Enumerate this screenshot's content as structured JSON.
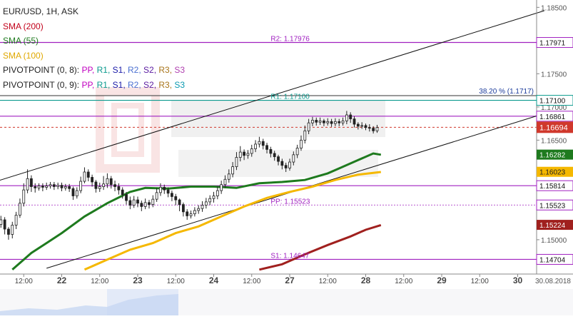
{
  "chart_data": {
    "type": "candlestick",
    "instrument": "EUR/USD, 1H, ASK",
    "legend": {
      "sma200": "SMA (200)",
      "sma55": "SMA (55)",
      "sma100": "SMA (100)",
      "pivot1_prefix": "PIVOTPOINT (0, 8): ",
      "pivot2_prefix": "PIVOTPOINT (0, 9): ",
      "pivot_labels": [
        "PP,",
        "R1,",
        "S1,",
        "R2,",
        "S2,",
        "R3,",
        "S3"
      ]
    },
    "colors": {
      "sma200": "#a0201e",
      "sma55": "#1e7a1e",
      "sma100": "#f5b800",
      "pivot_line": "#a020c0",
      "r1_line": "#0b9a8e",
      "current_price": "#d0382c"
    },
    "y_axis": {
      "ylim": [
        1.1455,
        1.1855
      ],
      "ticks": [
        1.185,
        1.18,
        1.175,
        1.17,
        1.165,
        1.16,
        1.155,
        1.15
      ],
      "tick_labels": [
        "1.18500",
        "1.18000",
        "1.17500",
        "1.17000",
        "1.16500",
        "1.16000",
        "1.15500",
        "1.15000"
      ]
    },
    "x_axis": {
      "ticks": [
        {
          "t": 0.5,
          "label": "12:00",
          "bold": false
        },
        {
          "t": 1.0,
          "label": "22",
          "bold": true
        },
        {
          "t": 1.5,
          "label": "12:00",
          "bold": false
        },
        {
          "t": 2.0,
          "label": "23",
          "bold": true
        },
        {
          "t": 2.5,
          "label": "12:00",
          "bold": false
        },
        {
          "t": 3.0,
          "label": "24",
          "bold": true
        },
        {
          "t": 3.5,
          "label": "12:00",
          "bold": false
        },
        {
          "t": 4.0,
          "label": "27",
          "bold": true
        },
        {
          "t": 4.5,
          "label": "12:00",
          "bold": false
        },
        {
          "t": 5.0,
          "label": "28",
          "bold": true
        },
        {
          "t": 5.5,
          "label": "12:00",
          "bold": false
        },
        {
          "t": 6.0,
          "label": "29",
          "bold": true
        },
        {
          "t": 6.5,
          "label": "12:00",
          "bold": false
        },
        {
          "t": 7.0,
          "label": "30",
          "bold": true
        }
      ],
      "end_label": "30.08.2018"
    },
    "horizontal_levels": [
      {
        "value": 1.17971,
        "tag": "1.17971",
        "label": "R2: 1.17976",
        "kind": "pivot"
      },
      {
        "value": 1.171,
        "tag": "1.17100",
        "label": "R1: 1.17100",
        "kind": "r1"
      },
      {
        "value": 1.16861,
        "tag": "1.16861",
        "label": "",
        "kind": "pivot"
      },
      {
        "value": 1.15814,
        "tag": "1.15814",
        "label": "",
        "kind": "pivot"
      },
      {
        "value": 1.15523,
        "tag": "1.15523",
        "label": "PP: 1.15523",
        "kind": "pp"
      },
      {
        "value": 1.14704,
        "tag": "1.14704",
        "label": "S1: 1.14647",
        "kind": "pivot"
      }
    ],
    "fib_label": "38.20 % (1.1717)",
    "fib_value": 1.1717,
    "current_price": {
      "value": 1.16694,
      "tag": "1.16694"
    },
    "sma_tags": [
      {
        "value": 1.16282,
        "tag": "1.16282",
        "series": "sma55"
      },
      {
        "value": 1.16023,
        "tag": "1.16023",
        "series": "sma100"
      },
      {
        "value": 1.15224,
        "tag": "1.15224",
        "series": "sma200"
      }
    ],
    "channel_lines": [
      {
        "from": [
          0.0,
          1.1583
        ],
        "to": [
          7.35,
          1.1845
        ]
      },
      {
        "from": [
          0.8,
          1.1457
        ],
        "to": [
          7.35,
          1.169
        ]
      }
    ],
    "sma55": [
      [
        0.35,
        1.1455
      ],
      [
        0.6,
        1.148
      ],
      [
        0.8,
        1.1495
      ],
      [
        1.0,
        1.151
      ],
      [
        1.3,
        1.1535
      ],
      [
        1.6,
        1.1555
      ],
      [
        1.9,
        1.1572
      ],
      [
        2.1,
        1.1578
      ],
      [
        2.4,
        1.1577
      ],
      [
        2.7,
        1.158
      ],
      [
        3.0,
        1.158
      ],
      [
        3.3,
        1.1578
      ],
      [
        3.6,
        1.1585
      ],
      [
        3.9,
        1.1587
      ],
      [
        4.2,
        1.159
      ],
      [
        4.5,
        1.16
      ],
      [
        4.7,
        1.161
      ],
      [
        4.9,
        1.162
      ],
      [
        5.1,
        1.163
      ],
      [
        5.2,
        1.1628
      ]
    ],
    "sma100": [
      [
        1.3,
        1.1455
      ],
      [
        1.6,
        1.147
      ],
      [
        1.9,
        1.1485
      ],
      [
        2.2,
        1.1495
      ],
      [
        2.5,
        1.151
      ],
      [
        2.8,
        1.152
      ],
      [
        3.1,
        1.1535
      ],
      [
        3.4,
        1.155
      ],
      [
        3.7,
        1.1563
      ],
      [
        4.0,
        1.1572
      ],
      [
        4.3,
        1.158
      ],
      [
        4.6,
        1.159
      ],
      [
        4.9,
        1.1598
      ],
      [
        5.2,
        1.1602
      ]
    ],
    "sma200": [
      [
        3.6,
        1.1455
      ],
      [
        3.9,
        1.1463
      ],
      [
        4.2,
        1.1478
      ],
      [
        4.5,
        1.1492
      ],
      [
        4.8,
        1.1505
      ],
      [
        5.0,
        1.1515
      ],
      [
        5.2,
        1.1522
      ]
    ],
    "candles": [
      [
        0.0,
        1.1535,
        1.1527,
        1.1543,
        1.152
      ],
      [
        0.05,
        1.1527,
        1.152,
        1.1533,
        1.1512
      ],
      [
        0.1,
        1.152,
        1.153,
        1.1536,
        1.1514
      ],
      [
        0.15,
        1.153,
        1.1523,
        1.1537,
        1.1517
      ],
      [
        0.2,
        1.1523,
        1.153,
        1.1536,
        1.1518
      ],
      [
        0.25,
        1.153,
        1.1516,
        1.1534,
        1.1508
      ],
      [
        0.3,
        1.1516,
        1.1508,
        1.1519,
        1.15
      ],
      [
        0.35,
        1.1508,
        1.1522,
        1.1527,
        1.1502
      ],
      [
        0.4,
        1.1522,
        1.1537,
        1.1542,
        1.1516
      ],
      [
        0.45,
        1.1537,
        1.1555,
        1.1562,
        1.1533
      ],
      [
        0.5,
        1.1555,
        1.1575,
        1.1585,
        1.155
      ],
      [
        0.55,
        1.1575,
        1.1592,
        1.1606,
        1.157
      ],
      [
        0.6,
        1.1592,
        1.158,
        1.1597,
        1.1572
      ],
      [
        0.65,
        1.158,
        1.1578,
        1.1585,
        1.1571
      ],
      [
        0.7,
        1.1578,
        1.1581,
        1.1585,
        1.1574
      ],
      [
        0.75,
        1.1581,
        1.1579,
        1.1585,
        1.1573
      ],
      [
        0.8,
        1.1579,
        1.1581,
        1.1586,
        1.1575
      ],
      [
        0.85,
        1.1581,
        1.1583,
        1.1587,
        1.1577
      ],
      [
        0.9,
        1.1583,
        1.158,
        1.1587,
        1.1575
      ],
      [
        0.95,
        1.158,
        1.1582,
        1.1586,
        1.1576
      ],
      [
        1.0,
        1.1582,
        1.1578,
        1.1586,
        1.1573
      ],
      [
        1.05,
        1.1578,
        1.158,
        1.1584,
        1.1574
      ],
      [
        1.1,
        1.158,
        1.1577,
        1.1584,
        1.1572
      ],
      [
        1.15,
        1.1577,
        1.1566,
        1.158,
        1.156
      ],
      [
        1.2,
        1.1566,
        1.1574,
        1.1579,
        1.1562
      ],
      [
        1.25,
        1.1574,
        1.1588,
        1.1595,
        1.157
      ],
      [
        1.3,
        1.1588,
        1.1602,
        1.1609,
        1.1585
      ],
      [
        1.35,
        1.1602,
        1.1594,
        1.1606,
        1.1588
      ],
      [
        1.4,
        1.1594,
        1.1587,
        1.1598,
        1.158
      ],
      [
        1.45,
        1.1587,
        1.1577,
        1.159,
        1.1571
      ],
      [
        1.5,
        1.1577,
        1.158,
        1.1586,
        1.1572
      ],
      [
        1.55,
        1.158,
        1.1584,
        1.1596,
        1.1575
      ],
      [
        1.6,
        1.1584,
        1.1592,
        1.16,
        1.1578
      ],
      [
        1.65,
        1.1592,
        1.1583,
        1.1596,
        1.1577
      ],
      [
        1.7,
        1.1583,
        1.158,
        1.1589,
        1.1573
      ],
      [
        1.75,
        1.158,
        1.1575,
        1.1585,
        1.1568
      ],
      [
        1.8,
        1.1575,
        1.1568,
        1.1579,
        1.1562
      ],
      [
        1.85,
        1.1568,
        1.1559,
        1.1572,
        1.1553
      ],
      [
        1.9,
        1.1559,
        1.1552,
        1.1565,
        1.1546
      ],
      [
        1.95,
        1.1552,
        1.156,
        1.1566,
        1.1548
      ],
      [
        2.0,
        1.156,
        1.1555,
        1.1565,
        1.1549
      ],
      [
        2.05,
        1.1555,
        1.155,
        1.1559,
        1.1543
      ],
      [
        2.1,
        1.155,
        1.1556,
        1.1562,
        1.1546
      ],
      [
        2.15,
        1.1556,
        1.1553,
        1.156,
        1.1547
      ],
      [
        2.2,
        1.1553,
        1.1561,
        1.1567,
        1.1549
      ],
      [
        2.25,
        1.1561,
        1.1571,
        1.1578,
        1.1557
      ],
      [
        2.3,
        1.1571,
        1.1579,
        1.1585,
        1.1566
      ],
      [
        2.35,
        1.1579,
        1.1575,
        1.1583,
        1.1569
      ],
      [
        2.4,
        1.1575,
        1.157,
        1.1579,
        1.1564
      ],
      [
        2.45,
        1.157,
        1.1565,
        1.1574,
        1.1558
      ],
      [
        2.5,
        1.1565,
        1.156,
        1.1569,
        1.1552
      ],
      [
        2.55,
        1.156,
        1.1553,
        1.1562,
        1.1543
      ],
      [
        2.6,
        1.1553,
        1.1542,
        1.1556,
        1.1535
      ],
      [
        2.65,
        1.1542,
        1.1536,
        1.1546,
        1.153
      ],
      [
        2.7,
        1.1536,
        1.1539,
        1.1544,
        1.1532
      ],
      [
        2.75,
        1.1539,
        1.1544,
        1.1549,
        1.1535
      ],
      [
        2.8,
        1.1544,
        1.1547,
        1.1552,
        1.1539
      ],
      [
        2.85,
        1.1547,
        1.1552,
        1.1558,
        1.1542
      ],
      [
        2.9,
        1.1552,
        1.1557,
        1.1563,
        1.1547
      ],
      [
        2.95,
        1.1557,
        1.1562,
        1.1567,
        1.1552
      ],
      [
        3.0,
        1.1562,
        1.1566,
        1.1572,
        1.1556
      ],
      [
        3.05,
        1.1566,
        1.1574,
        1.158,
        1.1561
      ],
      [
        3.1,
        1.1574,
        1.1583,
        1.1589,
        1.1569
      ],
      [
        3.15,
        1.1583,
        1.1591,
        1.1597,
        1.1578
      ],
      [
        3.2,
        1.1591,
        1.1599,
        1.1606,
        1.1586
      ],
      [
        3.25,
        1.1599,
        1.161,
        1.1617,
        1.1594
      ],
      [
        3.3,
        1.161,
        1.1624,
        1.1632,
        1.1605
      ],
      [
        3.35,
        1.1624,
        1.1632,
        1.1641,
        1.1618
      ],
      [
        3.4,
        1.1632,
        1.1627,
        1.1636,
        1.162
      ],
      [
        3.45,
        1.1627,
        1.163,
        1.1635,
        1.1622
      ],
      [
        3.5,
        1.163,
        1.1637,
        1.1643,
        1.1625
      ],
      [
        3.55,
        1.1637,
        1.1644,
        1.165,
        1.1632
      ],
      [
        3.6,
        1.1644,
        1.1648,
        1.1655,
        1.1639
      ],
      [
        3.65,
        1.1648,
        1.1642,
        1.1652,
        1.1636
      ],
      [
        3.7,
        1.1642,
        1.1636,
        1.1646,
        1.163
      ],
      [
        3.75,
        1.1636,
        1.163,
        1.164,
        1.1624
      ],
      [
        3.8,
        1.163,
        1.1625,
        1.1634,
        1.1619
      ],
      [
        3.85,
        1.1625,
        1.1618,
        1.1628,
        1.1612
      ],
      [
        3.9,
        1.1618,
        1.1612,
        1.1622,
        1.1606
      ],
      [
        3.95,
        1.1612,
        1.1608,
        1.1616,
        1.1602
      ],
      [
        4.0,
        1.1608,
        1.1617,
        1.1622,
        1.1604
      ],
      [
        4.05,
        1.1617,
        1.1628,
        1.1633,
        1.1612
      ],
      [
        4.1,
        1.1628,
        1.1638,
        1.1643,
        1.1623
      ],
      [
        4.15,
        1.1638,
        1.165,
        1.1657,
        1.1634
      ],
      [
        4.2,
        1.165,
        1.1664,
        1.1672,
        1.1645
      ],
      [
        4.25,
        1.1664,
        1.1676,
        1.1682,
        1.1659
      ],
      [
        4.3,
        1.1676,
        1.168,
        1.1685,
        1.1671
      ],
      [
        4.35,
        1.168,
        1.1677,
        1.1684,
        1.1672
      ],
      [
        4.4,
        1.1677,
        1.1679,
        1.1684,
        1.1673
      ],
      [
        4.45,
        1.1679,
        1.1676,
        1.1682,
        1.1671
      ],
      [
        4.5,
        1.1676,
        1.1678,
        1.1683,
        1.1672
      ],
      [
        4.55,
        1.1678,
        1.1675,
        1.1682,
        1.167
      ],
      [
        4.6,
        1.1675,
        1.1678,
        1.1683,
        1.1671
      ],
      [
        4.65,
        1.1678,
        1.1676,
        1.1682,
        1.1671
      ],
      [
        4.7,
        1.1676,
        1.1679,
        1.1684,
        1.1672
      ],
      [
        4.75,
        1.1679,
        1.1688,
        1.1694,
        1.1674
      ],
      [
        4.8,
        1.1688,
        1.1682,
        1.1692,
        1.1676
      ],
      [
        4.85,
        1.1682,
        1.1674,
        1.1686,
        1.1669
      ],
      [
        4.9,
        1.1674,
        1.1671,
        1.1677,
        1.1666
      ],
      [
        4.95,
        1.1671,
        1.1672,
        1.1677,
        1.1667
      ],
      [
        5.0,
        1.1672,
        1.1669,
        1.1675,
        1.1665
      ],
      [
        5.05,
        1.1669,
        1.1668,
        1.1674,
        1.1663
      ],
      [
        5.1,
        1.1668,
        1.1664,
        1.1671,
        1.166
      ],
      [
        5.15,
        1.1664,
        1.1669,
        1.1673,
        1.1661
      ]
    ]
  }
}
